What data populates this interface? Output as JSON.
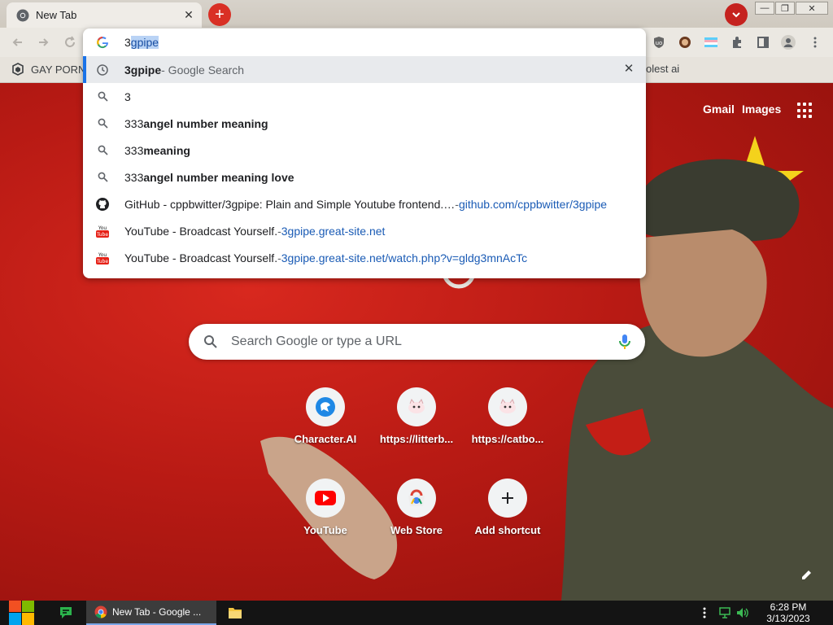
{
  "tab": {
    "title": "New Tab",
    "close_glyph": "✕"
  },
  "new_tab_glyph": "+",
  "window_buttons": {
    "minimize": "—",
    "restore": "❐",
    "close": "✕"
  },
  "bookmarks": {
    "item1": "GAY PORN",
    "item2_fragment": "olest ai"
  },
  "omnibox": {
    "typed_prefix": "3",
    "typed_selected": "gpipe",
    "suggestions": [
      {
        "icon": "clock-icon",
        "main": "3gpipe",
        "suffix": " - Google Search",
        "active": true
      },
      {
        "icon": "search-icon",
        "main": "3"
      },
      {
        "icon": "search-icon",
        "prefix": "333",
        "main": " angel number meaning"
      },
      {
        "icon": "search-icon",
        "prefix": "333",
        "main": " meaning"
      },
      {
        "icon": "search-icon",
        "prefix": "333",
        "main": " angel number meaning love"
      },
      {
        "icon": "github-icon",
        "title": "GitHub - cppbwitter/3gpipe: Plain and Simple Youtube frontend.…",
        "sep": " - ",
        "url": "github.com/cppbwitter/3gpipe"
      },
      {
        "icon": "youtube-icon",
        "title": "YouTube - Broadcast Yourself.",
        "sep": " - ",
        "url": "3gpipe.great-site.net"
      },
      {
        "icon": "youtube-icon",
        "title": "YouTube - Broadcast Yourself.",
        "sep": " - ",
        "url": "3gpipe.great-site.net/watch.php?v=gldg3mnAcTc"
      }
    ]
  },
  "ntp": {
    "gmail": "Gmail",
    "images": "Images",
    "search_placeholder": "Search Google or type a URL",
    "shortcuts": [
      {
        "label": "Character.AI",
        "icon": "character-ai-icon"
      },
      {
        "label": "https://litterb...",
        "icon": "litterbox-icon"
      },
      {
        "label": "https://catbo...",
        "icon": "catbox-icon"
      },
      {
        "label": "YouTube",
        "icon": "youtube-icon"
      },
      {
        "label": "Web Store",
        "icon": "web-store-icon"
      },
      {
        "label": "Add shortcut",
        "icon": "plus-icon"
      }
    ]
  },
  "taskbar": {
    "chrome_label": "New Tab - Google ...",
    "time": "6:28 PM",
    "date": "3/13/2023"
  },
  "colors": {
    "accent": "#1a73e8",
    "ntp_red": "#c41e16",
    "url_blue": "#1a5bb5"
  }
}
